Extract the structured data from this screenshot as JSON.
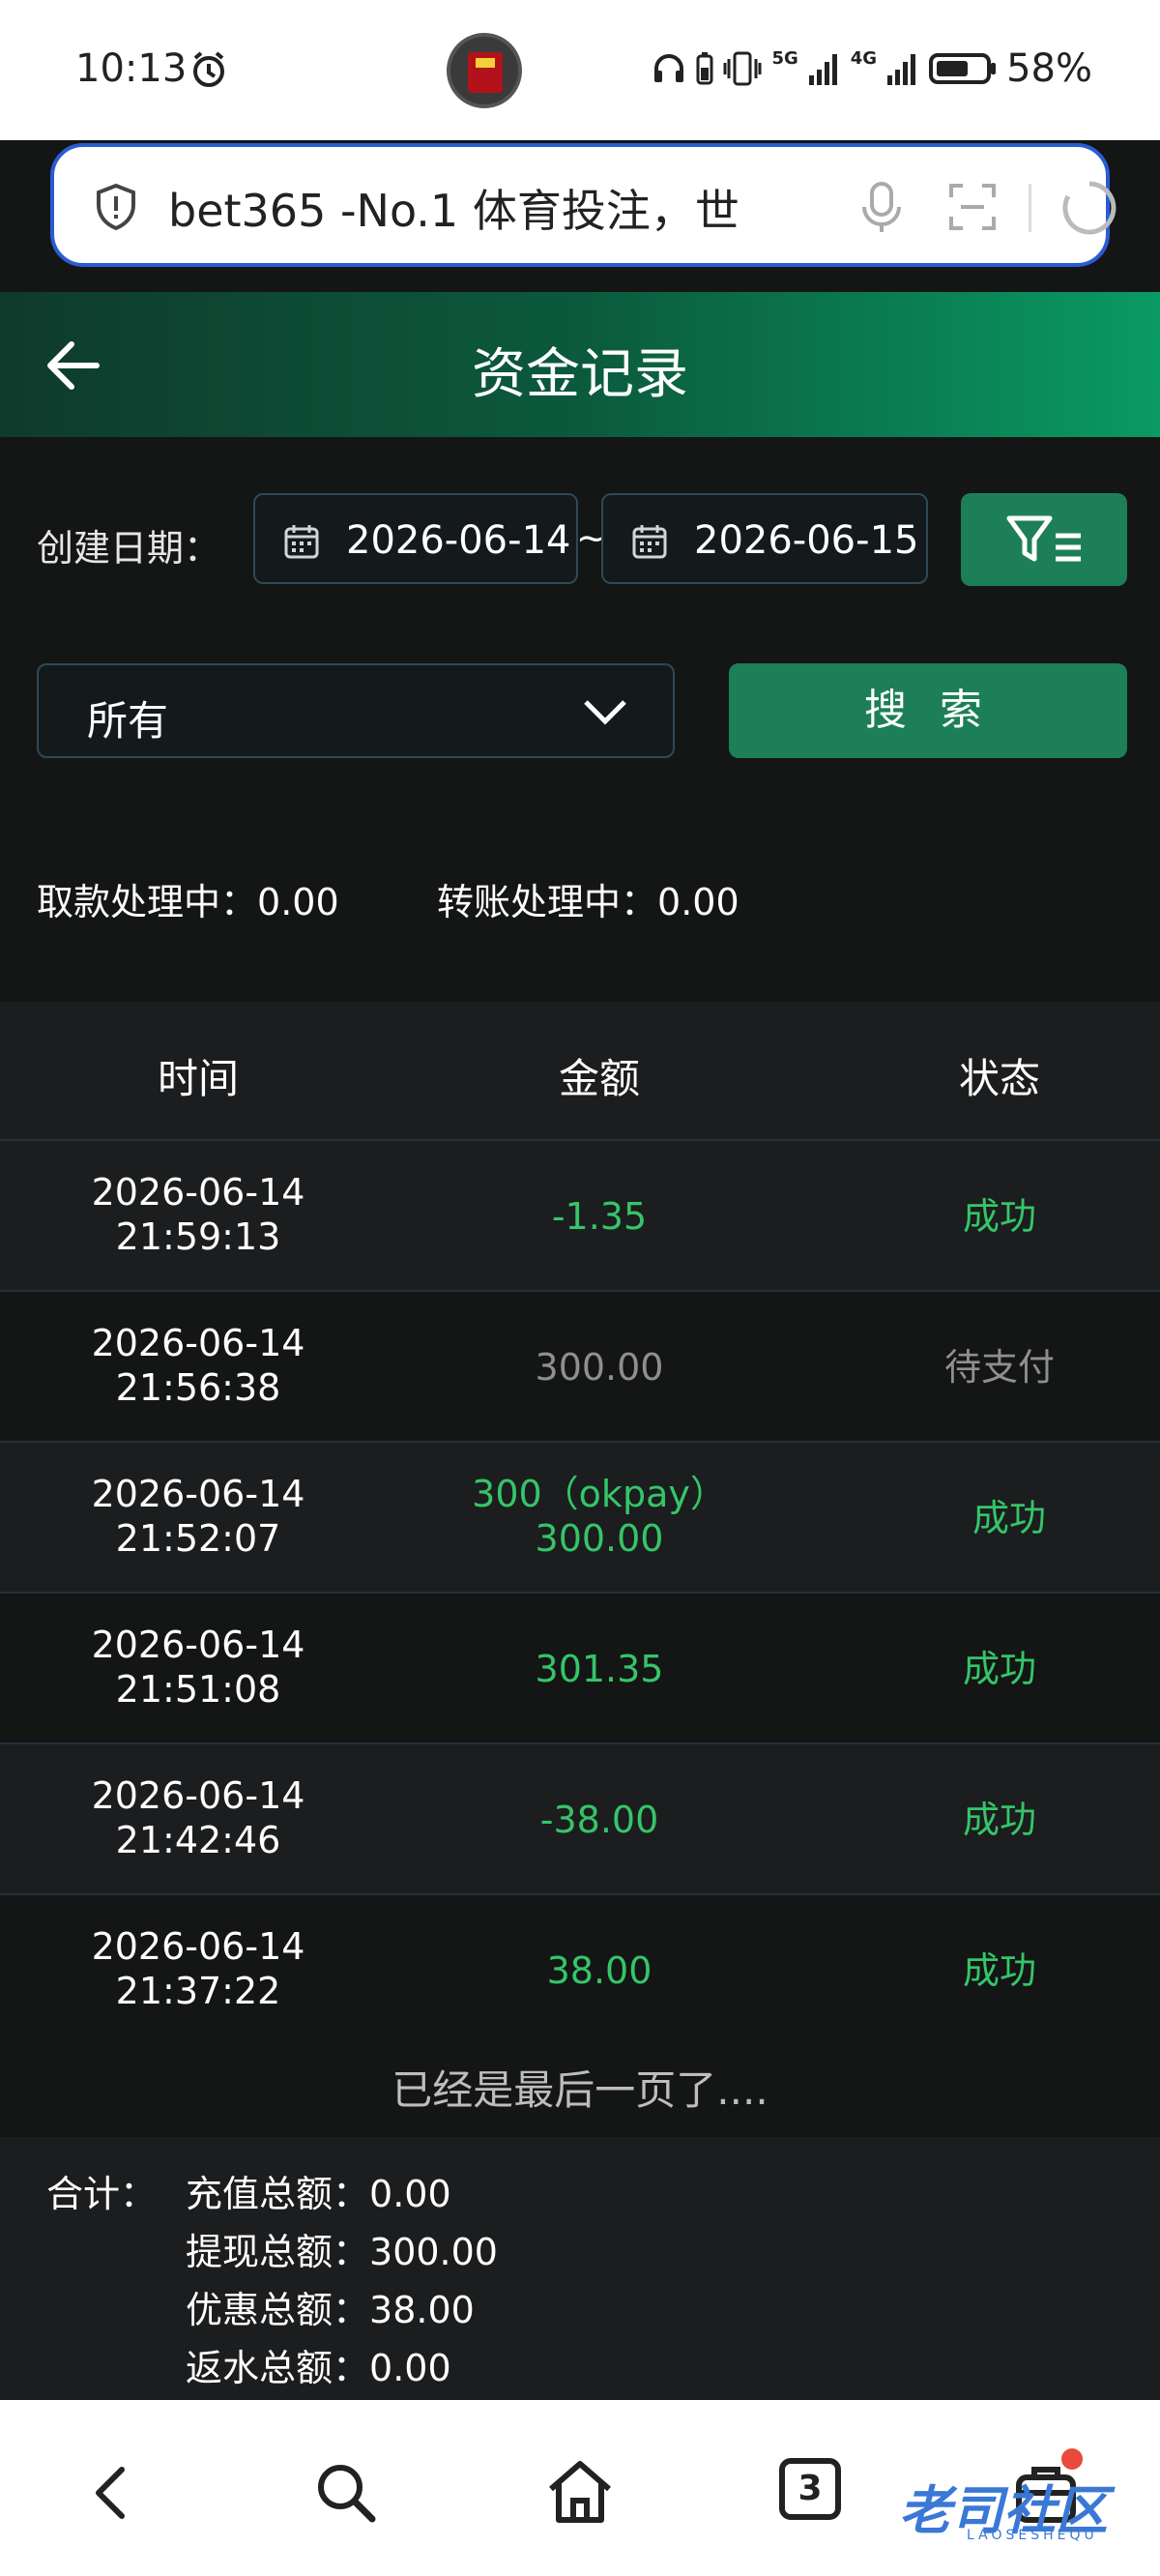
{
  "status_bar": {
    "time": "10:13",
    "network_5g": "5G",
    "network_4g": "4G",
    "battery": "58%"
  },
  "browser": {
    "url_text": "bet365 -No.1 体育投注，世"
  },
  "header": {
    "title": "资金记录"
  },
  "filters": {
    "date_label": "创建日期：",
    "start_date": "2026-06-14",
    "tilde": "~",
    "end_date": "2026-06-15",
    "type_select": "所有",
    "search_label": "搜 索"
  },
  "processing": {
    "withdraw_label": "取款处理中：",
    "withdraw_value": "0.00",
    "transfer_label": "转账处理中：",
    "transfer_value": "0.00"
  },
  "table": {
    "headers": [
      "时间",
      "金额",
      "状态"
    ],
    "rows": [
      {
        "date": "2026-06-14",
        "time": "21:59:13",
        "amount": "-1.35",
        "amount_extra": "",
        "status": "成功"
      },
      {
        "date": "2026-06-14",
        "time": "21:56:38",
        "amount": "300.00",
        "amount_extra": "",
        "status": "待支付"
      },
      {
        "date": "2026-06-14",
        "time": "21:52:07",
        "amount": "300.00",
        "amount_extra": "300（okpay）",
        "status": "成功"
      },
      {
        "date": "2026-06-14",
        "time": "21:51:08",
        "amount": "301.35",
        "amount_extra": "",
        "status": "成功"
      },
      {
        "date": "2026-06-14",
        "time": "21:42:46",
        "amount": "-38.00",
        "amount_extra": "",
        "status": "成功"
      },
      {
        "date": "2026-06-14",
        "time": "21:37:22",
        "amount": "38.00",
        "amount_extra": "",
        "status": "成功"
      }
    ],
    "last_page_text": "已经是最后一页了...."
  },
  "summary": {
    "label": "合计：",
    "lines": [
      {
        "label": "充值总额：",
        "value": "0.00"
      },
      {
        "label": "提现总额：",
        "value": "300.00"
      },
      {
        "label": "优惠总额：",
        "value": "38.00"
      },
      {
        "label": "返水总额：",
        "value": "0.00"
      }
    ]
  },
  "bottom_nav": {
    "tabs_count": "3",
    "watermark": "老司社区",
    "watermark_sub": "LAOSESHEQU"
  },
  "colors": {
    "accent_green": "#1d7f57",
    "success_text": "#35c56a",
    "pending_text": "#8f8f8f",
    "url_border": "#2b5cd6"
  }
}
